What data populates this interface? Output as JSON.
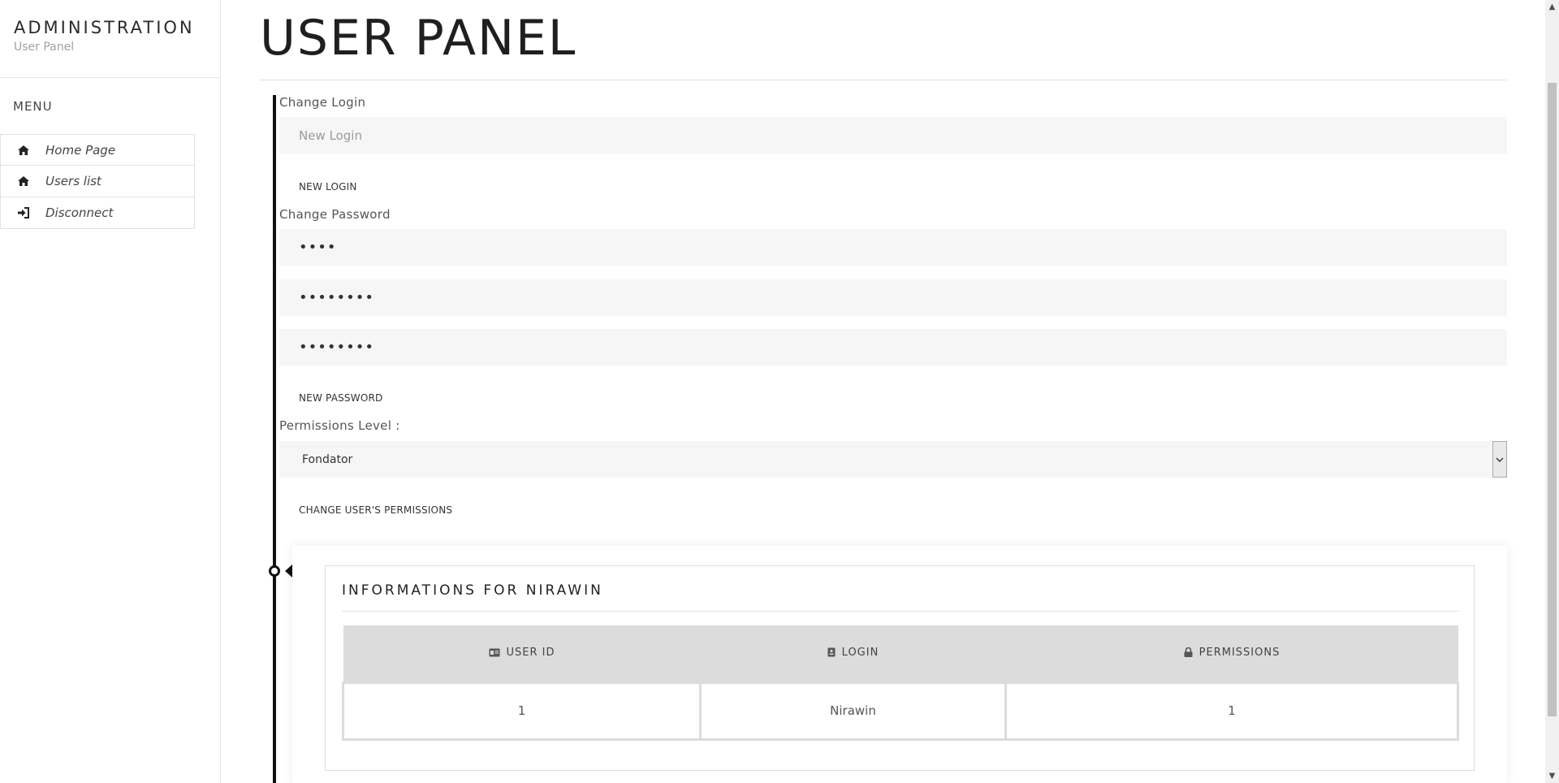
{
  "sidebar": {
    "title": "ADMINISTRATION",
    "subtitle": "User Panel",
    "menu_label": "MENU",
    "items": [
      {
        "label": "Home Page",
        "icon": "home-icon"
      },
      {
        "label": "Users list",
        "icon": "home-icon"
      },
      {
        "label": "Disconnect",
        "icon": "sign-in-icon"
      }
    ]
  },
  "main": {
    "title": "USER PANEL",
    "change_login": {
      "label": "Change Login",
      "placeholder": "New Login",
      "help": "NEW LOGIN"
    },
    "change_password": {
      "label": "Change Password",
      "fields": [
        "••••",
        "••••••••",
        "••••••••"
      ],
      "help": "NEW PASSWORD"
    },
    "permissions": {
      "label": "Permissions Level :",
      "selected": "Fondator",
      "help": "CHANGE USER'S PERMISSIONS"
    },
    "info_card": {
      "title": "INFORMATIONS FOR NIRAWIN",
      "columns": [
        "USER ID",
        "LOGIN",
        "PERMISSIONS"
      ],
      "column_icons": [
        "id-card-icon",
        "badge-icon",
        "lock-icon"
      ],
      "row": [
        "1",
        "Nirawin",
        "1"
      ]
    }
  },
  "colors": {
    "accent": "#111111",
    "field_bg": "#f6f6f7",
    "table_header_bg": "#dcdcdc"
  }
}
